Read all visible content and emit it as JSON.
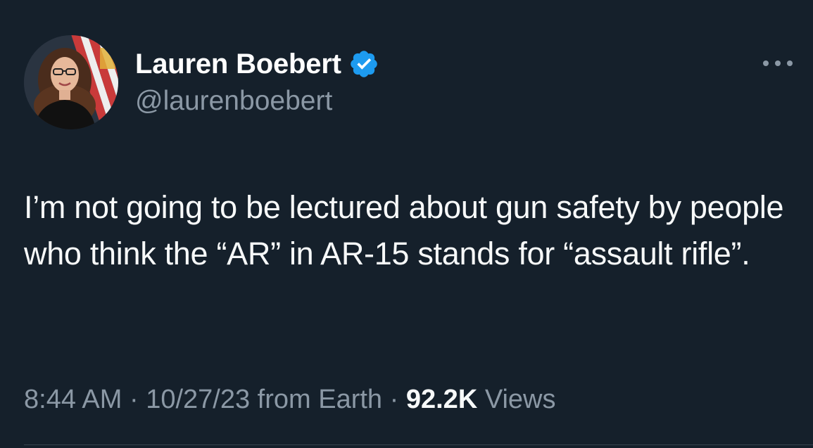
{
  "tweet": {
    "author": {
      "display_name": "Lauren Boebert",
      "handle": "@laurenboebert",
      "verified": true
    },
    "text": "I’m not going to be lectured about gun safety by people who think the “AR” in AR-15 stands for “assault rifle”.",
    "meta": {
      "time": "8:44 AM",
      "sep1": " · ",
      "date": "10/27/23",
      "location": " from Earth",
      "sep2": " · ",
      "views_count": "92.2K",
      "views_label": " Views"
    }
  },
  "icons": {
    "verified": "verified-badge-icon",
    "more": "more-horizontal-icon"
  },
  "colors": {
    "background": "#15202b",
    "text_primary": "#f7f9f9",
    "text_secondary": "#8b98a5",
    "verified_blue": "#1d9bf0",
    "divider": "#38444d"
  }
}
